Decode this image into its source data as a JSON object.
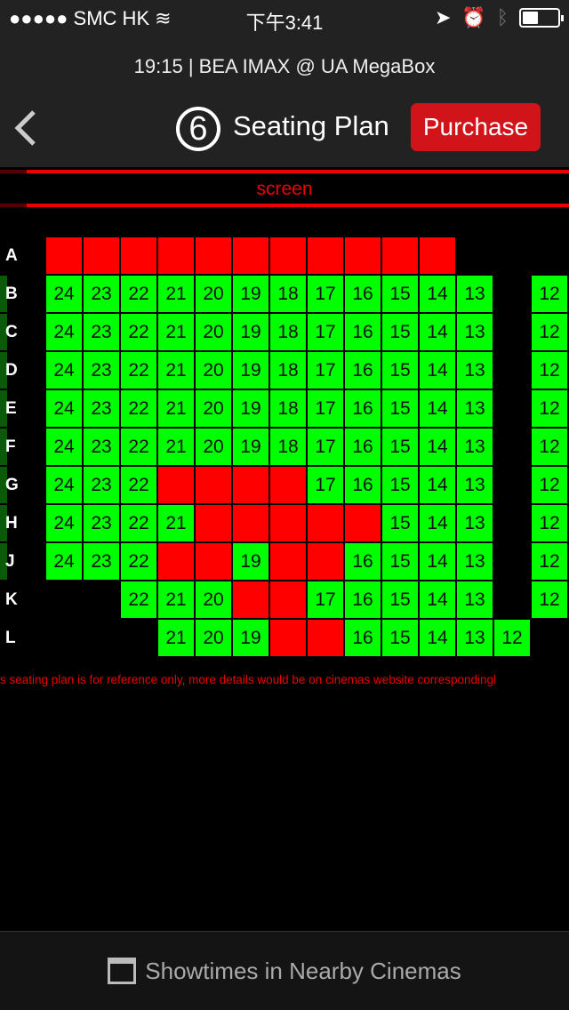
{
  "status_bar": {
    "carrier": "●●●●● SMC HK",
    "time": "下午3:41",
    "battery_level": 0.4
  },
  "header": {
    "subtitle": "19:15 | BEA IMAX @ UA MegaBox",
    "logo": "6",
    "title": "Seating Plan",
    "purchase_label": "Purchase"
  },
  "screen_label": "screen",
  "colors": {
    "available": "#00ff00",
    "taken": "#ff0000",
    "accent": "#d0141a"
  },
  "seating": {
    "rows": [
      {
        "label": "A",
        "marked": false,
        "seats": [
          "x",
          "x",
          "x",
          "x",
          "x",
          "x",
          "x",
          "x",
          "x",
          "x",
          "x",
          null,
          null,
          null
        ]
      },
      {
        "label": "B",
        "marked": true,
        "seats": [
          "24",
          "23",
          "22",
          "21",
          "20",
          "19",
          "18",
          "17",
          "16",
          "15",
          "14",
          "13",
          null,
          "12"
        ]
      },
      {
        "label": "C",
        "marked": true,
        "seats": [
          "24",
          "23",
          "22",
          "21",
          "20",
          "19",
          "18",
          "17",
          "16",
          "15",
          "14",
          "13",
          null,
          "12"
        ]
      },
      {
        "label": "D",
        "marked": true,
        "seats": [
          "24",
          "23",
          "22",
          "21",
          "20",
          "19",
          "18",
          "17",
          "16",
          "15",
          "14",
          "13",
          null,
          "12"
        ]
      },
      {
        "label": "E",
        "marked": true,
        "seats": [
          "24",
          "23",
          "22",
          "21",
          "20",
          "19",
          "18",
          "17",
          "16",
          "15",
          "14",
          "13",
          null,
          "12"
        ]
      },
      {
        "label": "F",
        "marked": true,
        "seats": [
          "24",
          "23",
          "22",
          "21",
          "20",
          "19",
          "18",
          "17",
          "16",
          "15",
          "14",
          "13",
          null,
          "12"
        ]
      },
      {
        "label": "G",
        "marked": true,
        "seats": [
          "24",
          "23",
          "22",
          "x",
          "x",
          "x",
          "x",
          "17",
          "16",
          "15",
          "14",
          "13",
          null,
          "12"
        ]
      },
      {
        "label": "H",
        "marked": true,
        "seats": [
          "24",
          "23",
          "22",
          "21",
          "x",
          "x",
          "x",
          "x",
          "x",
          "15",
          "14",
          "13",
          null,
          "12"
        ]
      },
      {
        "label": "J",
        "marked": true,
        "seats": [
          "24",
          "23",
          "22",
          "x",
          "x",
          "19",
          "x",
          "x",
          "16",
          "15",
          "14",
          "13",
          null,
          "12"
        ]
      },
      {
        "label": "K",
        "marked": false,
        "seats": [
          null,
          null,
          "22",
          "21",
          "20",
          "x",
          "x",
          "17",
          "16",
          "15",
          "14",
          "13",
          null,
          "12"
        ]
      },
      {
        "label": "L",
        "marked": false,
        "seats": [
          null,
          null,
          null,
          "21",
          "20",
          "19",
          "x",
          "x",
          "16",
          "15",
          "14",
          "13",
          "12",
          null
        ]
      }
    ]
  },
  "note": "s seating plan is for reference only, more details would be on cinemas website correspondingl",
  "bottom": {
    "label": "Showtimes in Nearby Cinemas",
    "icon": "calendar-icon"
  }
}
